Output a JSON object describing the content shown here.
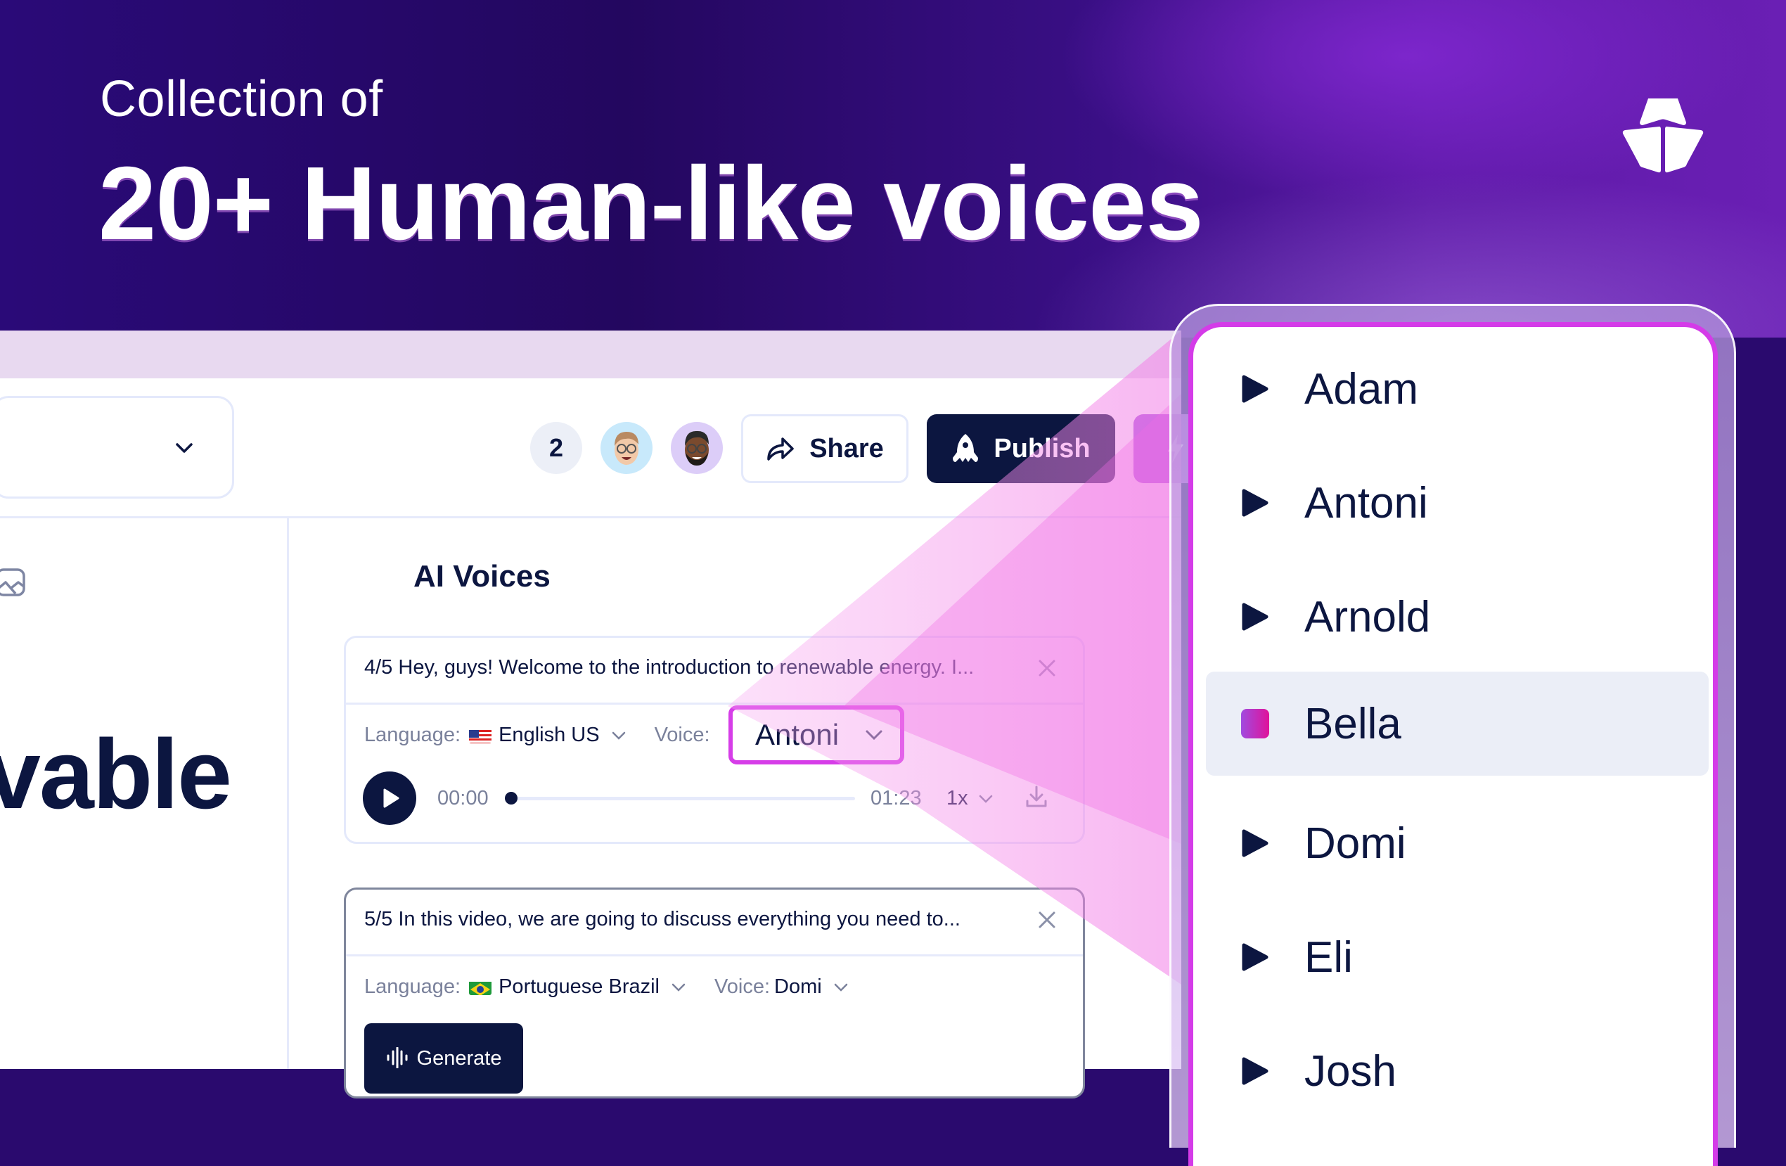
{
  "hero": {
    "subtitle": "Collection of",
    "title": "20+ Human-like voices"
  },
  "brand": {
    "logo_icon": "ship-bow-logo-icon"
  },
  "toolbar": {
    "collaborator_count": "2",
    "share_label": "Share",
    "publish_label": "Publish"
  },
  "editor": {
    "visible_word": "vable"
  },
  "ai_voices": {
    "title": "AI Voices",
    "cards": [
      {
        "script": "4/5 Hey, guys! Welcome to the introduction to renewable energy. I...",
        "language_label": "Language:",
        "language_flag": "🇺🇸",
        "language": "English US",
        "voice_label": "Voice:",
        "voice": "Antoni",
        "time_current": "00:00",
        "time_total": "01:23",
        "progress": 0,
        "speed": "1x"
      },
      {
        "script": "5/5 In this video, we are going to discuss everything you need to...",
        "language_label": "Language:",
        "language_flag": "🇧🇷",
        "language": "Portuguese Brazil",
        "voice_label": "Voice:",
        "voice": "Domi",
        "generate_label": "Generate"
      }
    ]
  },
  "voice_dropdown": {
    "items": [
      {
        "name": "Adam",
        "state": "idle"
      },
      {
        "name": "Antoni",
        "state": "idle"
      },
      {
        "name": "Arnold",
        "state": "idle"
      },
      {
        "name": "Bella",
        "state": "playing"
      },
      {
        "name": "Domi",
        "state": "idle"
      },
      {
        "name": "Eli",
        "state": "idle"
      },
      {
        "name": "Josh",
        "state": "idle"
      }
    ]
  },
  "colors": {
    "navy": "#0c1640",
    "accent_magenta": "#d43be8",
    "hero_purple": "#23075f",
    "highlight_row": "#ebeef7"
  }
}
